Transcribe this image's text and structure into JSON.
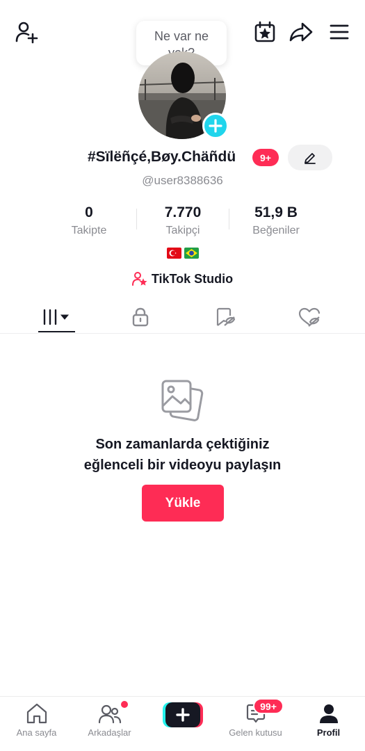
{
  "header": {
    "bubble_line1": "Ne var ne",
    "bubble_line2": "yok?"
  },
  "profile": {
    "display_name": "#Sïlëñçé,Bøy.Chäñdü",
    "notifications_badge": "9+",
    "username": "@user8388636",
    "flags": [
      "turkey-flag",
      "brazil-flag"
    ],
    "studio_label": "TikTok Studio"
  },
  "stats": [
    {
      "value": "0",
      "label": "Takipte"
    },
    {
      "value": "7.770",
      "label": "Takipçi"
    },
    {
      "value": "51,9 B",
      "label": "Beğeniler"
    }
  ],
  "tabs": [
    "videos-grid-icon",
    "lock-icon",
    "repost-icon",
    "liked-heart-icon"
  ],
  "empty_state": {
    "line1": "Son zamanlarda çektiğiniz",
    "line2": "eğlenceli bir videoyu paylaşın",
    "button": "Yükle"
  },
  "bottom_nav": {
    "home": "Ana sayfa",
    "friends": "Arkadaşlar",
    "inbox": "Gelen kutusu",
    "inbox_badge": "99+",
    "profile": "Profil"
  },
  "colors": {
    "accent": "#fe2c55",
    "cyan": "#20d5ec",
    "text": "#161823",
    "muted": "#8a8b91"
  }
}
